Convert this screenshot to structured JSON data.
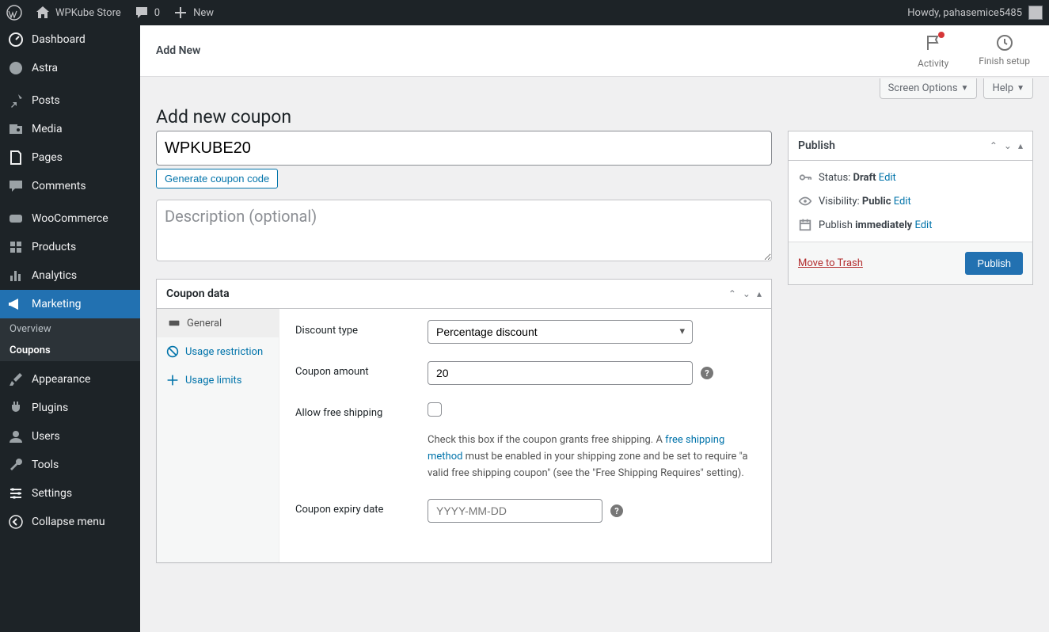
{
  "adminbar": {
    "site_name": "WPKube Store",
    "comments_count": "0",
    "new_label": "New",
    "howdy": "Howdy, pahasemice5485"
  },
  "sidebar": {
    "items": [
      {
        "label": "Dashboard"
      },
      {
        "label": "Astra"
      },
      {
        "label": "Posts"
      },
      {
        "label": "Media"
      },
      {
        "label": "Pages"
      },
      {
        "label": "Comments"
      },
      {
        "label": "WooCommerce"
      },
      {
        "label": "Products"
      },
      {
        "label": "Analytics"
      },
      {
        "label": "Marketing"
      },
      {
        "label": "Appearance"
      },
      {
        "label": "Plugins"
      },
      {
        "label": "Users"
      },
      {
        "label": "Tools"
      },
      {
        "label": "Settings"
      },
      {
        "label": "Collapse menu"
      }
    ],
    "marketing_sub": [
      {
        "label": "Overview"
      },
      {
        "label": "Coupons"
      }
    ]
  },
  "topbar": {
    "title": "Add New",
    "activity": "Activity",
    "finish": "Finish setup"
  },
  "screen_options": "Screen Options",
  "help": "Help",
  "page_title": "Add new coupon",
  "coupon": {
    "code": "WPKUBE20",
    "generate_btn": "Generate coupon code",
    "desc_placeholder": "Description (optional)"
  },
  "coupon_data": {
    "title": "Coupon data",
    "tabs": {
      "general": "General",
      "usage_restriction": "Usage restriction",
      "usage_limits": "Usage limits"
    },
    "labels": {
      "discount_type": "Discount type",
      "coupon_amount": "Coupon amount",
      "free_shipping": "Allow free shipping",
      "expiry": "Coupon expiry date"
    },
    "values": {
      "discount_type": "Percentage discount",
      "coupon_amount": "20",
      "expiry_placeholder": "YYYY-MM-DD"
    },
    "free_shipping_text": {
      "pre": "Check this box if the coupon grants free shipping. A ",
      "link": "free shipping method",
      "post": " must be enabled in your shipping zone and be set to require \"a valid free shipping coupon\" (see the \"Free Shipping Requires\" setting)."
    }
  },
  "publish": {
    "title": "Publish",
    "status_label": "Status: ",
    "status_value": "Draft",
    "visibility_label": "Visibility: ",
    "visibility_value": "Public",
    "publish_label": "Publish ",
    "publish_value": "immediately",
    "edit": "Edit",
    "trash": "Move to Trash",
    "publish_btn": "Publish"
  }
}
